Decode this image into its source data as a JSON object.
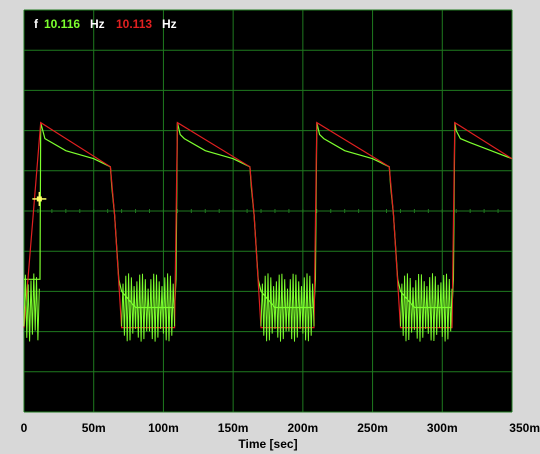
{
  "readout": {
    "prefix": "f",
    "freq_green": "10.116",
    "unit_green": "Hz",
    "freq_red": "10.113",
    "unit_red": "Hz"
  },
  "colors": {
    "background": "#000000",
    "grid": "#1f7a1f",
    "trace_green": "#7dff2e",
    "trace_red": "#e02020",
    "readout_label": "#ffffff",
    "cursor": "#ffff66",
    "frame": "#d8d8d8"
  },
  "chart_data": {
    "type": "line",
    "xlabel": "Time [sec]",
    "x_ticks": [
      "0",
      "50m",
      "100m",
      "150m",
      "200m",
      "250m",
      "300m",
      "350m"
    ],
    "xlim": [
      0,
      0.35
    ],
    "ylim": [
      0,
      10
    ],
    "grid": true,
    "series": [
      {
        "color": "green",
        "x": [
          0,
          0.008,
          0.0115,
          0.012,
          0.015,
          0.03,
          0.05,
          0.062,
          0.063,
          0.065,
          0.068,
          0.07,
          0.08,
          0.09,
          0.1,
          0.108,
          0.109,
          0.11,
          0.112,
          0.115,
          0.13,
          0.15,
          0.162,
          0.163,
          0.165,
          0.168,
          0.17,
          0.18,
          0.19,
          0.2,
          0.208,
          0.209,
          0.21,
          0.212,
          0.215,
          0.23,
          0.25,
          0.262,
          0.263,
          0.265,
          0.268,
          0.27,
          0.28,
          0.29,
          0.3,
          0.307,
          0.308,
          0.309,
          0.31,
          0.313,
          0.32,
          0.335,
          0.35
        ],
        "y": [
          3.3,
          3.3,
          3.3,
          7.2,
          6.8,
          6.5,
          6.3,
          6.1,
          5.6,
          4.9,
          3.3,
          3.0,
          2.6,
          2.6,
          2.6,
          2.6,
          3.3,
          7.2,
          6.9,
          6.8,
          6.5,
          6.3,
          6.1,
          5.6,
          4.9,
          3.3,
          3.0,
          2.6,
          2.6,
          2.6,
          2.6,
          3.3,
          7.2,
          6.9,
          6.8,
          6.5,
          6.3,
          6.1,
          5.6,
          4.9,
          3.3,
          3.0,
          2.6,
          2.6,
          2.6,
          2.6,
          3.3,
          7.2,
          7.0,
          6.8,
          6.7,
          6.5,
          6.3
        ]
      },
      {
        "color": "red",
        "x": [
          0,
          0.012,
          0.062,
          0.065,
          0.07,
          0.108,
          0.11,
          0.162,
          0.165,
          0.17,
          0.208,
          0.21,
          0.262,
          0.265,
          0.27,
          0.307,
          0.309,
          0.35
        ],
        "y": [
          2.1,
          7.2,
          6.1,
          4.9,
          2.1,
          2.1,
          7.2,
          6.1,
          4.9,
          2.1,
          2.1,
          7.2,
          6.1,
          4.9,
          2.1,
          2.1,
          7.2,
          6.3
        ]
      }
    ]
  }
}
